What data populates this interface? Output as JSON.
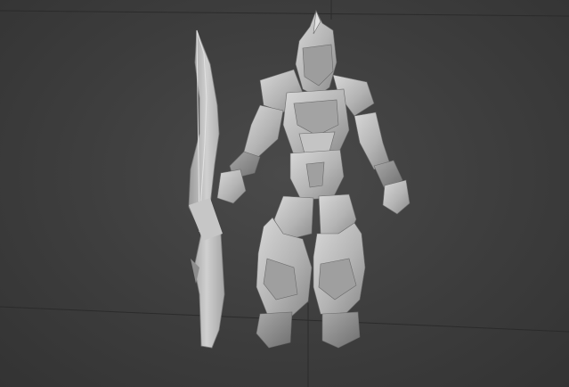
{
  "viewport": {
    "mode": "perspective",
    "shading": "default-shading",
    "background_color": "#3e3e3e",
    "grid_color": "#2a2a2a",
    "model_color": "#b9b9b9"
  },
  "scene": {
    "model": "armored-warrior-with-sword",
    "grid_visible": true
  }
}
